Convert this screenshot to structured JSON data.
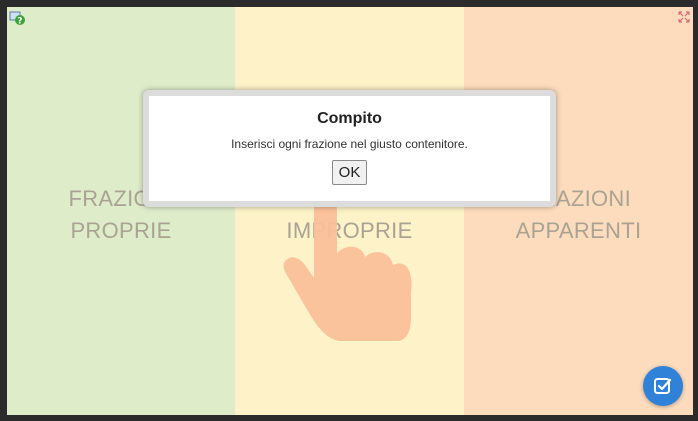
{
  "columns": [
    {
      "id": "green",
      "line1": "FRAZIONI",
      "line2": "PROPRIE",
      "color": "#dfecca"
    },
    {
      "id": "yellow",
      "line1": "FRAZIONI",
      "line2": "IMPROPRIE",
      "color": "#fdf2c8"
    },
    {
      "id": "orange",
      "line1": "FRAZIONI",
      "line2": "APPARENTI",
      "color": "#fcdcbc"
    }
  ],
  "dialog": {
    "title": "Compito",
    "message": "Inserisci ogni frazione nel giusto contenitore.",
    "ok_label": "OK"
  },
  "icons": {
    "top_left": "help-icon",
    "top_right": "fullscreen-icon",
    "hand": "hand-pointer-icon",
    "check": "check-icon"
  },
  "colors": {
    "accent": "#2f82d8",
    "hand": "#fbc09a"
  }
}
